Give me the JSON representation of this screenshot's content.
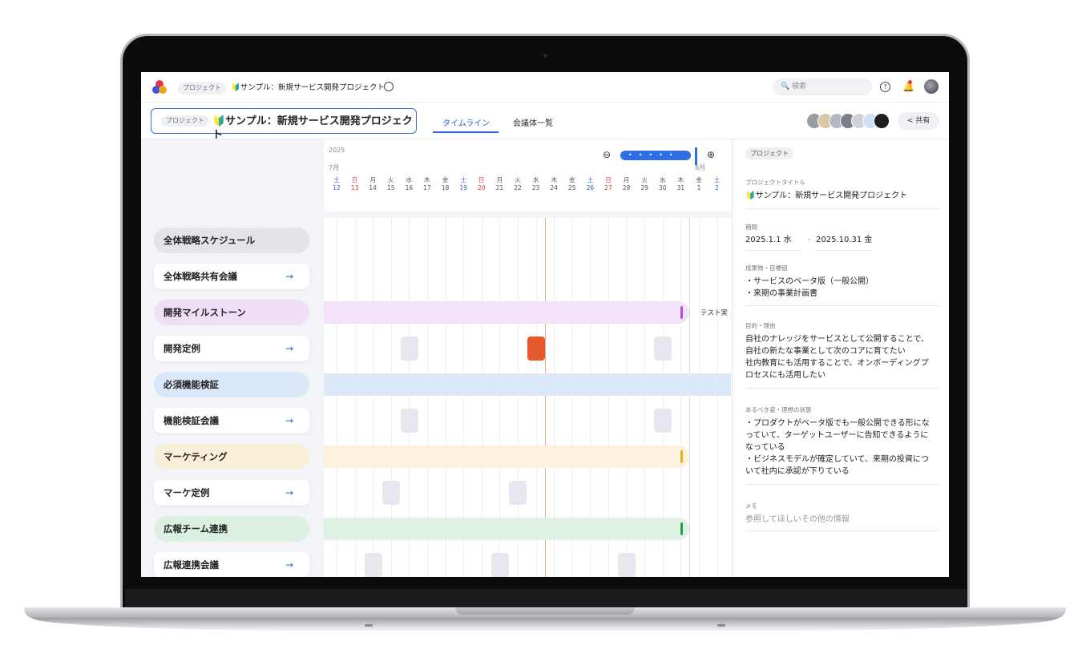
{
  "breadcrumb": {
    "chip": "プロジェクト",
    "title": "🔰サンプル：新規サービス開発プロジェクト"
  },
  "search": {
    "placeholder": "🔍 検索"
  },
  "project_header": {
    "chip": "プロジェクト",
    "title": "🔰サンプル：新規サービス開発プロジェクト"
  },
  "tabs": [
    {
      "label": "タイムライン",
      "active": true
    },
    {
      "label": "会議体一覧",
      "active": false
    }
  ],
  "share_label": "< 共有",
  "timeline": {
    "year": "2025",
    "months": [
      "7月",
      "8月"
    ],
    "days": [
      {
        "w": "土",
        "d": "12",
        "color": "blue"
      },
      {
        "w": "日",
        "d": "13",
        "color": "red"
      },
      {
        "w": "月",
        "d": "14"
      },
      {
        "w": "火",
        "d": "15"
      },
      {
        "w": "水",
        "d": "16"
      },
      {
        "w": "木",
        "d": "17"
      },
      {
        "w": "金",
        "d": "18"
      },
      {
        "w": "土",
        "d": "19",
        "color": "blue"
      },
      {
        "w": "日",
        "d": "20",
        "color": "red"
      },
      {
        "w": "月",
        "d": "21"
      },
      {
        "w": "火",
        "d": "22"
      },
      {
        "w": "水",
        "d": "23"
      },
      {
        "w": "木",
        "d": "24"
      },
      {
        "w": "金",
        "d": "25"
      },
      {
        "w": "土",
        "d": "26",
        "color": "blue"
      },
      {
        "w": "日",
        "d": "27",
        "color": "red"
      },
      {
        "w": "月",
        "d": "28"
      },
      {
        "w": "火",
        "d": "29"
      },
      {
        "w": "水",
        "d": "30"
      },
      {
        "w": "木",
        "d": "31"
      },
      {
        "w": "金",
        "d": "1"
      },
      {
        "w": "土",
        "d": "2",
        "color": "blue"
      }
    ],
    "next_label": "テスト実"
  },
  "rows": [
    {
      "label": "全体戦略スケジュール",
      "type": "group",
      "bg": "#e3e4e9"
    },
    {
      "label": "全体戦略共有会議",
      "type": "meeting"
    },
    {
      "label": "開発マイルストーン",
      "type": "group",
      "bg": "#efe0f7",
      "bar": "#f3e3fa",
      "mark": "#b44fd6"
    },
    {
      "label": "開発定例",
      "type": "meeting"
    },
    {
      "label": "必須機能検証",
      "type": "group",
      "bg": "#dae7f8",
      "bar": "#dce9f9"
    },
    {
      "label": "機能検証会議",
      "type": "meeting"
    },
    {
      "label": "マーケティング",
      "type": "group",
      "bg": "#f9efd8",
      "bar": "#fbf1dc",
      "mark": "#e8b21f"
    },
    {
      "label": "マーケ定例",
      "type": "meeting"
    },
    {
      "label": "広報チーム連携",
      "type": "group",
      "bg": "#dbf0e0",
      "bar": "#dff2e3",
      "mark": "#28a447"
    },
    {
      "label": "広報連携会議",
      "type": "meeting"
    }
  ],
  "panel": {
    "chip": "プロジェクト",
    "title_label": "プロジェクトタイトル",
    "title_value": "🔰サンプル：新規サービス開発プロジェクト",
    "period_label": "期間",
    "period_start": "2025.1.1 水",
    "period_sep": "-",
    "period_end": "2025.10.31 金",
    "deliverables_label": "成果物・目標値",
    "deliverables": [
      "・サービスのベータ版（一般公開）",
      "・来期の事業計画書"
    ],
    "purpose_label": "目的・理由",
    "purpose": [
      "自社のナレッジをサービスとして公開することで、",
      "自社の新たな事業として次のコアに育てたい",
      "社内教育にも活用することで、オンボーディングプ",
      "ロセスにも活用したい"
    ],
    "ideal_label": "あるべき姿・理想の状態",
    "ideal": [
      "・プロダクトがベータ版でも一般公開できる形にな",
      "っていて、ターゲットユーザーに告知できるように",
      "なっている",
      "・ビジネスモデルが確定していて、来期の投資につ",
      "いて社内に承認が下りている"
    ],
    "memo_label": "メモ",
    "memo_placeholder": "参照してほしいその他の情報"
  },
  "colors": {
    "accent": "#2a66d9",
    "today": "#f2a88a",
    "hot_meeting": "#e55a2b"
  }
}
